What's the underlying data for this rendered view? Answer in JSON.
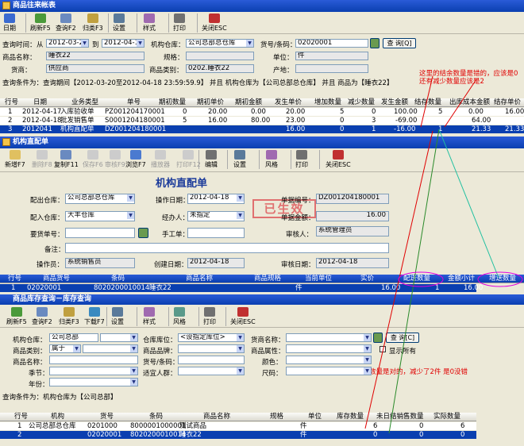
{
  "main": {
    "title": "商品往来帐表",
    "toolbar": [
      "日期",
      "刷新F5",
      "查询F2",
      "归类F3",
      "设置",
      "样式",
      "打印",
      "关闭ESC"
    ],
    "f_time_label": "查询时间：",
    "f_from": "从",
    "f_date_from": "2012-03-20",
    "f_to": "到",
    "f_date_to": "2012-04-18",
    "f_wh_label": "机构仓库：",
    "f_wh": "公司总部总仓库",
    "f_code_label": "货号/条码：",
    "f_code": "02020001",
    "f_query": "查 询[Q]",
    "f_name_label": "商品名称：",
    "f_name": "睡衣22",
    "f_spec_label": "规格：",
    "f_spec": "",
    "f_unit_label": "单位：",
    "f_unit": "件",
    "f_sup_label": "货商：",
    "f_sup": "供应商",
    "f_cat_label": "商品类别：",
    "f_cat": "0202.睡衣22",
    "f_origin_label": "产地：",
    "f_origin": "",
    "cond": "查询条件为：查询期间【2012-03-20至2012-04-18 23:59:59.9】 并且 机构仓库为【公司总部总仓库】 并且 商品为【睡衣22】",
    "headers": [
      "行号",
      "日期",
      "业务类型",
      "单号",
      "期初数量",
      "期初单价",
      "期初金额",
      "发生单价",
      "增加数量",
      "减少数量",
      "发生金额",
      "结存数量",
      "出库成本金额",
      "结存单价"
    ],
    "rows": [
      [
        "1",
        "2012-04-17",
        "入库验收单",
        "PZ001204170001",
        "0",
        "20.00",
        "0.00",
        "20.00",
        "5",
        "0",
        "100.00",
        "5",
        "0.00",
        "16.00"
      ],
      [
        "2",
        "2012-04-18",
        "批发销售单",
        "S0001204180001",
        "5",
        "16.00",
        "80.00",
        "23.00",
        "0",
        "3",
        "-69.00",
        "",
        "64.00",
        ""
      ],
      [
        "3",
        "2012041",
        "机构直配单",
        "DZ001204180001",
        "",
        "",
        "",
        "16.00",
        "0",
        "1",
        "-16.00",
        "1",
        "21.33",
        "21.33"
      ]
    ]
  },
  "note1": "这里的结余数量是错的，应该是0",
  "note2": "还有减少数量应该是2",
  "note3": "库存数量是对的，减少了2件 是0没错",
  "dist": {
    "title": "机构直配单",
    "heading": "机构直配单",
    "toolbar": [
      "新增F7",
      "删除F8",
      "复制F11",
      "保存F6",
      "审核F9",
      "浏览F7",
      "播放器",
      "打印F12",
      "编辑",
      "设置",
      "风格",
      "打印",
      "关闭ESC"
    ],
    "out_wh_label": "配出仓库：",
    "out_wh": "公司总部总仓库",
    "op_date_label": "操作日期：",
    "op_date": "2012-04-18",
    "doc_no_label": "单据编号：",
    "doc_no": "DZ001204180001",
    "in_wh_label": "配入仓库：",
    "in_wh": "大丰仓库",
    "handler_label": "经办人：",
    "handler": "未指定",
    "amount_label": "单据金额：",
    "amount": "16.00",
    "req_label": "要货单号：",
    "manual_label": "手工单：",
    "auditor_label": "审核人：",
    "auditor": "系统管理员",
    "remark_label": "备注：",
    "operator_label": "操作员：",
    "operator": "系统销售员",
    "create_label": "创建日期：",
    "create_date": "2012-04-18",
    "audit_label": "审核日期：",
    "audit_date": "2012-04-18",
    "stamp": "已生效",
    "headers": [
      "行号",
      "商品货号",
      "条码",
      "商品名称",
      "商品规格",
      "当前单位",
      "实价",
      "配送数量",
      "金额小计",
      "增送数量"
    ],
    "row": [
      "1",
      "02020001",
      "8020200010014",
      "睡衣22",
      "",
      "件",
      "16.00",
      "1",
      "16.00",
      ""
    ]
  },
  "stock": {
    "title": "商品库存查询－库存查询",
    "toolbar": [
      "刷新F5",
      "查询F2",
      "归类F3",
      "下载F7",
      "设置",
      "样式",
      "风格",
      "打印",
      "关闭ESC"
    ],
    "org_label": "机构仓库：",
    "org": "公司总部",
    "loc_label": "仓库库位：",
    "loc": "<设指定库位>",
    "pname_label": "货商名称：",
    "query": "查 询[C]",
    "cat_label": "商品类别：",
    "cat": "属于",
    "brand_label": "商品品牌：",
    "attr_label": "商品属性：",
    "showall": "显示所有",
    "name_label": "商品名称：",
    "code_label": "货号/条码：",
    "color_label": "颜色：",
    "season_label": "季节：",
    "crowd_label": "适宜人群：",
    "size_label": "尺码：",
    "year_label": "年份：",
    "cond": "查询条件为：机构仓库为【公司总部】",
    "headers": [
      "行号",
      "机构",
      "货号",
      "条码",
      "商品名称",
      "规格",
      "单位",
      "库存数量",
      "未日结销售数量",
      "实际数量"
    ],
    "rows": [
      [
        "1",
        "公司总部总仓库",
        "0201000",
        "8000001000001",
        "测试商品",
        "",
        "件",
        "6",
        "0",
        "6"
      ],
      [
        "2",
        "",
        "02020001",
        "8020200010014",
        "睡衣22",
        "",
        "件",
        "0",
        "0",
        "0"
      ]
    ]
  }
}
